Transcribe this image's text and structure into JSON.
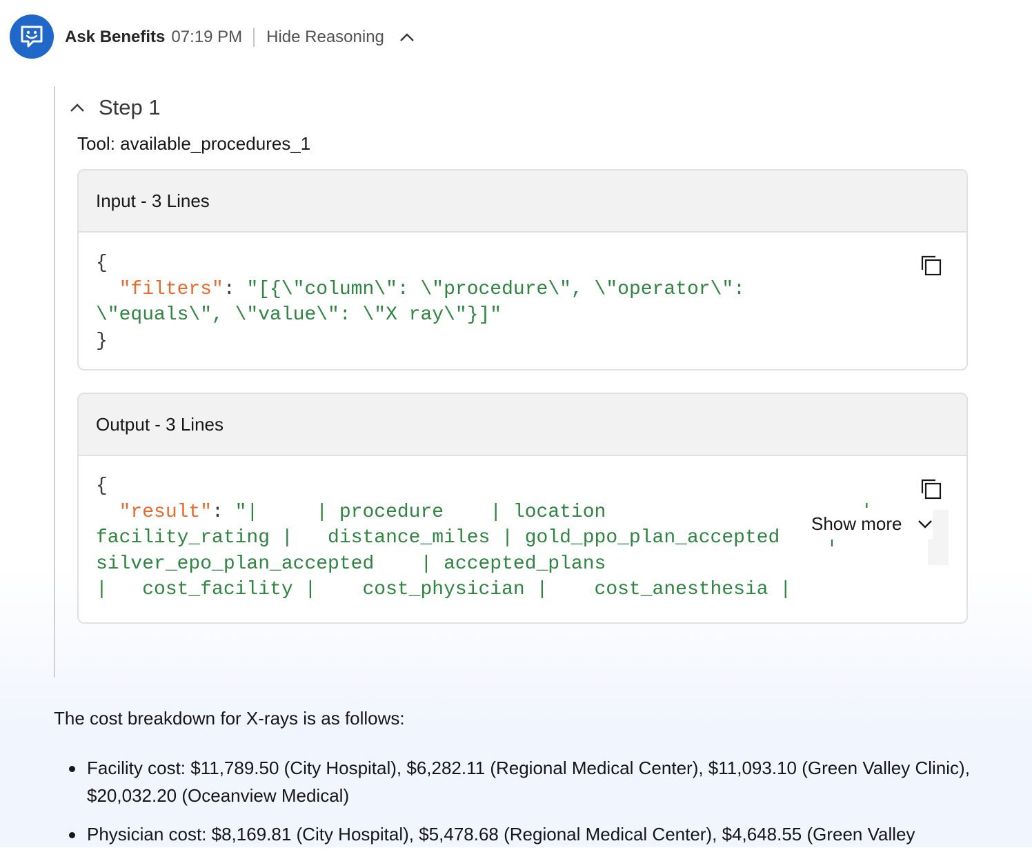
{
  "message": {
    "author": "Ask Benefits",
    "time": "07:19 PM",
    "reasoning_toggle_label": "Hide Reasoning"
  },
  "reasoning": {
    "step_title": "Step 1",
    "tool_line": "Tool: available_procedures_1",
    "input_panel": {
      "title": "Input - 3 Lines",
      "open_brace": "{",
      "key": "\"filters\"",
      "colon": ": ",
      "value_line1": "\"[{\\\"column\\\": \\\"procedure\\\", \\\"operator\\\":",
      "value_line2": "\\\"equals\\\", \\\"value\\\": \\\"X ray\\\"}]\"",
      "close_brace": "}"
    },
    "output_panel": {
      "title": "Output - 3 Lines",
      "open_brace": "{",
      "key": "\"result\"",
      "colon": ": ",
      "value_line1": "\"|     | procedure    | location                      |",
      "value_line2": "facility_rating |   distance_miles | gold_ppo_plan_accepted    |",
      "value_line3": "silver_epo_plan_accepted    | accepted_plans",
      "value_line4": "|   cost_facility |    cost_physician |    cost_anesthesia |",
      "show_more_label": "Show more"
    }
  },
  "answer": {
    "intro": "The cost breakdown for X-rays is as follows:",
    "bullets": [
      "Facility cost: $11,789.50 (City Hospital), $6,282.11 (Regional Medical Center), $11,093.10 (Green Valley Clinic), $20,032.20 (Oceanview Medical)",
      "Physician cost: $8,169.81 (City Hospital), $5,478.68 (Regional Medical Center), $4,648.55 (Green Valley"
    ]
  },
  "colors": {
    "avatar_bg": "#1f68c9",
    "json_key": "#eb6a2b",
    "json_string": "#2e8540"
  },
  "icons": {
    "avatar": "chat-bot-icon",
    "reasoning_toggle": "chevron-up-icon",
    "step_toggle": "chevron-up-icon",
    "copy": "copy-icon",
    "show_more": "chevron-down-icon"
  }
}
